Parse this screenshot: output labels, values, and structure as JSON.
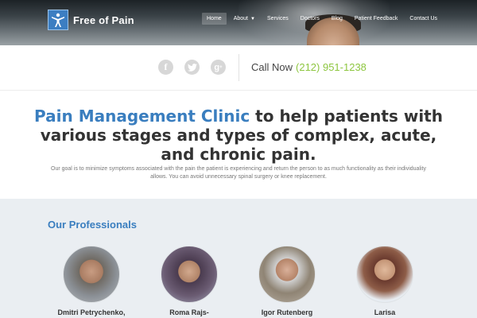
{
  "header": {
    "logo_text": "Free of Pain",
    "logo_icon": "person-figure-icon",
    "nav": [
      {
        "label": "Home",
        "active": true
      },
      {
        "label": "About",
        "dropdown": true
      },
      {
        "label": "Services"
      },
      {
        "label": "Doctors"
      },
      {
        "label": "Blog"
      },
      {
        "label": "Patient Feedback"
      },
      {
        "label": "Contact Us"
      }
    ]
  },
  "contact": {
    "social": [
      "facebook-icon",
      "twitter-icon",
      "google-plus-icon"
    ],
    "call_label": "Call Now",
    "phone": "(212) 951-1238",
    "phone_color": "#8dc63f"
  },
  "hero": {
    "heading_highlight": "Pain Management Clinic",
    "heading_rest": " to help patients with various stages and types of complex, acute, and chronic pain.",
    "subtext": "Our goal is to minimize symptoms associated with the pain the patient is experiencing and return the person to as much functionality as their individuality allows. You can avoid unnecessary spinal surgery or knee replacement.",
    "accent_color": "#3a7ebf"
  },
  "professionals": {
    "title": "Our Professionals",
    "doctors": [
      {
        "name": "Dmitri Petrychenko,"
      },
      {
        "name": "Roma Rajs-"
      },
      {
        "name": "Igor Rutenberg"
      },
      {
        "name": "Larisa"
      }
    ]
  }
}
